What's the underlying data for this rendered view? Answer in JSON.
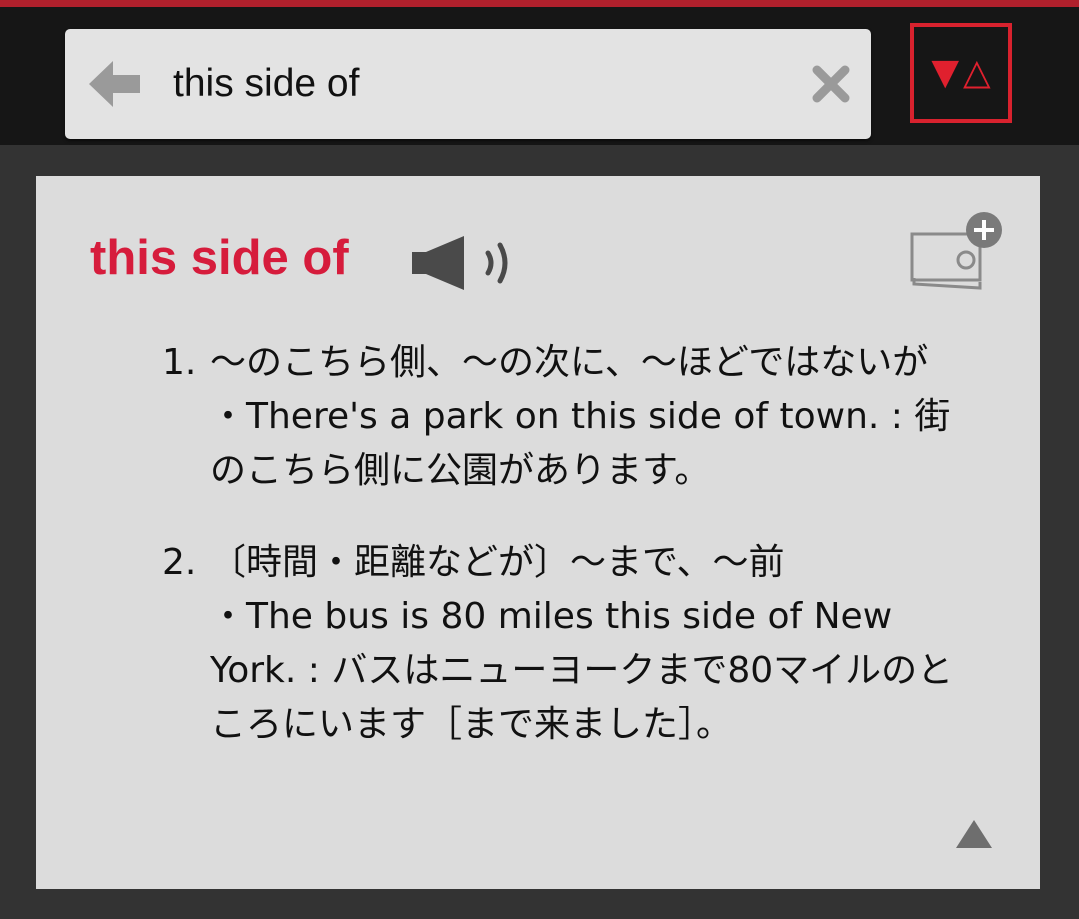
{
  "search": {
    "value": "this side of"
  },
  "entry": {
    "headword": "this side of",
    "definitions": [
      {
        "number": "1.",
        "meaning": "〜のこちら側、〜の次に、〜ほどではないが",
        "example": "・There's a park on this side of town. : 街のこちら側に公園があります。"
      },
      {
        "number": "2.",
        "meaning": "〔時間・距離などが〕〜まで、〜前",
        "example": "・The bus is 80 miles this side of New York. : バスはニューヨークまで80マイルのところにいます［まで来ました］。"
      }
    ]
  },
  "icons": {
    "back": "arrow-left-icon",
    "clear": "close-icon",
    "toggle_down": "▼",
    "toggle_up": "△",
    "speaker": "speaker-icon",
    "add_card": "add-flashcard-icon",
    "scroll_top": "triangle-up-icon"
  },
  "colors": {
    "accent": "#d61c3c",
    "topbar": "#161616",
    "background": "#333333",
    "card": "#dcdcdc",
    "search_box": "#e3e3e3",
    "toggle_border": "#d8222e"
  }
}
